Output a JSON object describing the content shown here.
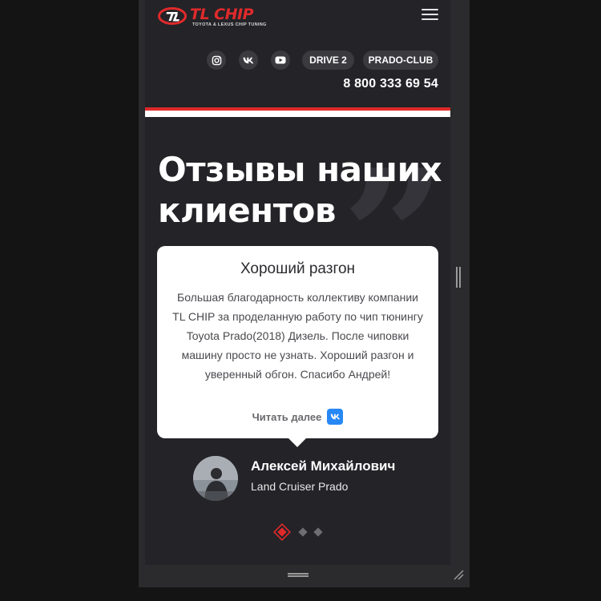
{
  "brand": {
    "logo_text": "TL CHIP",
    "tagline": "TOYOTA & LEXUS CHIP TUNING",
    "accent": "#e02a2a"
  },
  "header": {
    "menu_icon": "hamburger-menu-icon",
    "socials": [
      {
        "name": "instagram",
        "icon": "instagram-icon"
      },
      {
        "name": "vk",
        "icon": "vk-icon"
      },
      {
        "name": "youtube",
        "icon": "youtube-icon"
      }
    ],
    "links": [
      "DRIVE 2",
      "PRADO-CLUB"
    ],
    "phone": "8 800 333 69 54"
  },
  "section": {
    "title_line1": "Отзывы наших",
    "title_line2": "клиентов"
  },
  "review": {
    "title": "Хороший разгон",
    "text": "Большая благодарность коллективу компании TL CHIP за проделанную работу по чип тюнингу Toyota Prado(2018) Дизель. После чиповки машину просто не узнать. Хороший разгон и уверенный обгон. Спасибо Андрей!",
    "read_more": "Читать далее",
    "source_icon": "vk-icon",
    "source_color": "#2787f5"
  },
  "author": {
    "name": "Алексей Михайлович",
    "car": "Land Cruiser Prado"
  },
  "pagination": {
    "count": 3,
    "active_index": 0
  }
}
